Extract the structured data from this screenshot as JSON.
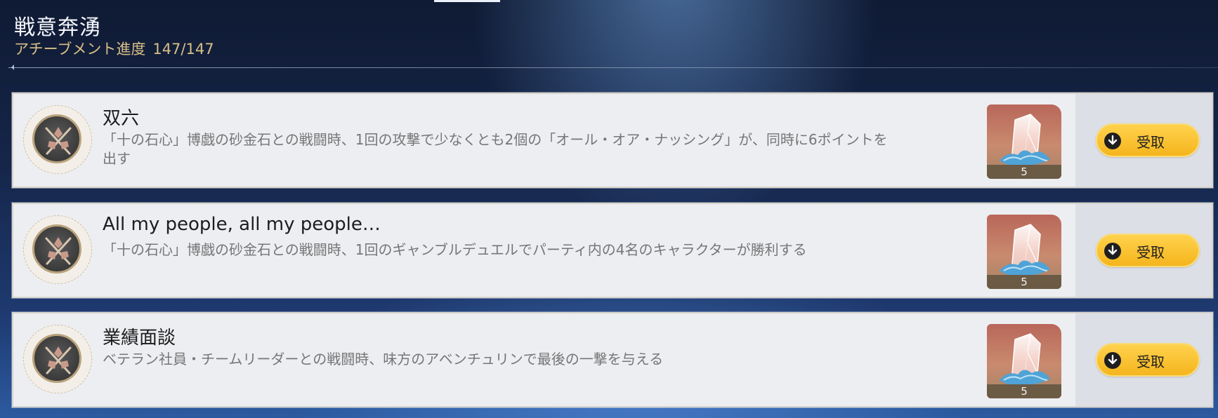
{
  "header": {
    "title": "戦意奔湧",
    "progress_label": "アチーブメント進度",
    "progress_count": "147/147"
  },
  "achievements": [
    {
      "title": "双六",
      "description": "「十の石心」博戯の砂金石との戦闘時、1回の攻撃で少なくとも2個の「オール・オア・ナッシング」が、同時に6ポイントを出す",
      "reward_count": "5",
      "reward_icon": "stellar-jade-icon",
      "claim_label": "受取"
    },
    {
      "title": "All my people, all my people…",
      "description": "「十の石心」博戯の砂金石との戦闘時、1回のギャンブルデュエルでパーティ内の4名のキャラクターが勝利する",
      "reward_count": "5",
      "reward_icon": "stellar-jade-icon",
      "claim_label": "受取"
    },
    {
      "title": "業績面談",
      "description": "ベテラン社員・チームリーダーとの戦闘時、味方のアベンチュリンで最後の一撃を与える",
      "reward_count": "5",
      "reward_icon": "stellar-jade-icon",
      "claim_label": "受取"
    }
  ],
  "colors": {
    "claim_button": "#f5b51d",
    "progress_text": "#d9bf86",
    "badge_ring": "#b9a27c"
  }
}
